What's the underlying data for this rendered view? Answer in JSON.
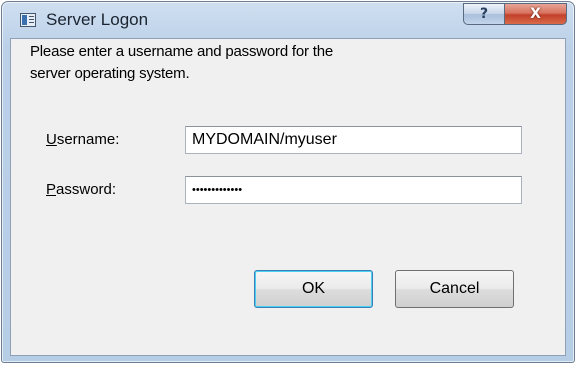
{
  "window": {
    "title": "Server Logon",
    "help_label": "?",
    "close_label": "X"
  },
  "prompt": {
    "line1": "Please enter a username and password for the",
    "line2": "server operating system."
  },
  "fields": {
    "username": {
      "label_mnemonic": "U",
      "label_rest": "sername:",
      "value": "MYDOMAIN/myuser"
    },
    "password": {
      "label_mnemonic": "P",
      "label_rest": "assword:",
      "value": "•••••••••••••"
    }
  },
  "buttons": {
    "ok_label": "OK",
    "cancel_label": "Cancel"
  },
  "colors": {
    "title_bar": "#bcd1e8",
    "close_button": "#c2412a",
    "dialog_body": "#f0f0f0"
  },
  "icons": [
    "app-window-icon",
    "help-icon",
    "close-icon"
  ]
}
